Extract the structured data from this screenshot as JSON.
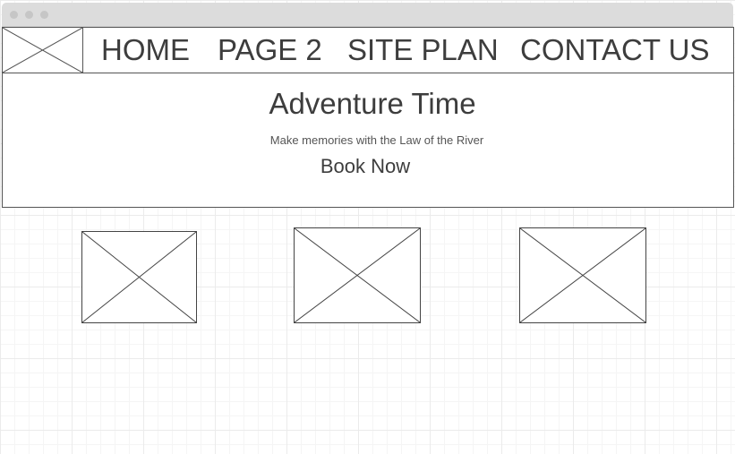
{
  "nav": {
    "logo_icon": "image-placeholder-icon",
    "items": [
      {
        "label": "HOME"
      },
      {
        "label": "PAGE 2"
      },
      {
        "label": "SITE PLAN"
      },
      {
        "label": "CONTACT US"
      }
    ]
  },
  "hero": {
    "title": "Adventure Time",
    "subtitle": "Make memories with the Law of the River",
    "cta_label": "Book Now"
  },
  "gallery": {
    "items": [
      {
        "icon": "image-placeholder-icon"
      },
      {
        "icon": "image-placeholder-icon"
      },
      {
        "icon": "image-placeholder-icon"
      }
    ]
  },
  "colors": {
    "stroke": "#444444",
    "titlebar": "#dcdcdc",
    "grid": "#ebebeb"
  }
}
